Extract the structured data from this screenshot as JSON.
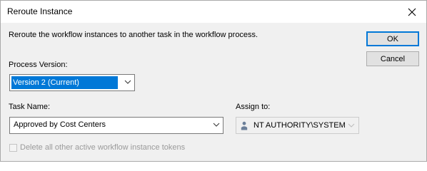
{
  "window": {
    "title": "Reroute Instance",
    "close_icon": "close-icon"
  },
  "instruction": "Reroute the workflow instances to another task in the workflow process.",
  "buttons": {
    "ok_label": "OK",
    "cancel_label": "Cancel"
  },
  "process_version": {
    "label": "Process Version:",
    "selected": "Version 2 (Current)"
  },
  "task_name": {
    "label": "Task Name:",
    "selected": "Approved by Cost Centers"
  },
  "assign_to": {
    "label": "Assign to:",
    "selected": "NT AUTHORITY\\SYSTEM",
    "icon": "user-icon",
    "disabled": true
  },
  "delete_tokens": {
    "label": "Delete all other active workflow instance tokens",
    "checked": false,
    "disabled": true
  },
  "colors": {
    "accent": "#0078d7",
    "dialog_bg": "#f0f0f0",
    "disabled_text": "#9a9a9a"
  }
}
